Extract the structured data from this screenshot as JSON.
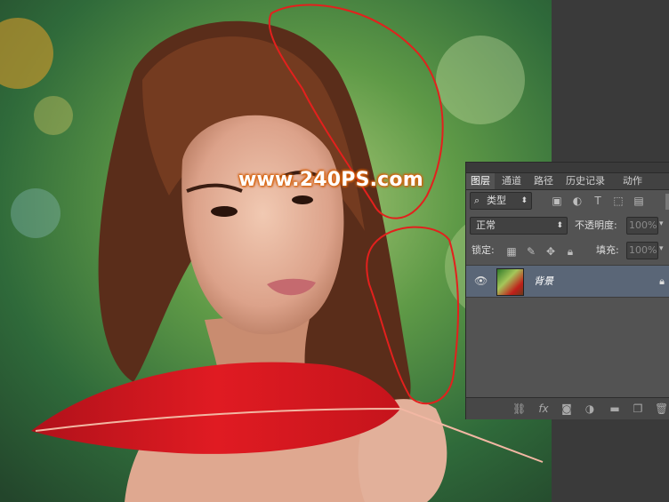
{
  "canvas": {
    "watermark": "www.240PS.com"
  },
  "layers_panel": {
    "tabs": [
      {
        "label": "图层",
        "active": true
      },
      {
        "label": "通道",
        "active": false
      },
      {
        "label": "路径",
        "active": false
      },
      {
        "label": "历史记录",
        "active": false
      },
      {
        "label": "动作",
        "active": false
      }
    ],
    "filter_kind": "类型",
    "blend_mode": "正常",
    "opacity_label": "不透明度:",
    "opacity_value": "100%",
    "lock_label": "锁定:",
    "fill_label": "填充:",
    "fill_value": "100%",
    "layers": [
      {
        "name": "背景",
        "visible": true,
        "locked": true
      }
    ],
    "icons": {
      "filter_icons": [
        "image-icon",
        "adjustment-icon",
        "type-icon",
        "shape-icon",
        "smart-object-icon"
      ],
      "lock_icons": [
        "lock-transparent-icon",
        "lock-brush-icon",
        "lock-move-icon",
        "lock-all-icon"
      ],
      "footer_icons": [
        "link-icon",
        "fx-icon",
        "mask-icon",
        "adjustment-layer-icon",
        "folder-icon",
        "new-layer-icon",
        "trash-icon"
      ]
    },
    "accent_colors": {
      "selected_row": "#5a6677",
      "panel": "#535353"
    }
  }
}
